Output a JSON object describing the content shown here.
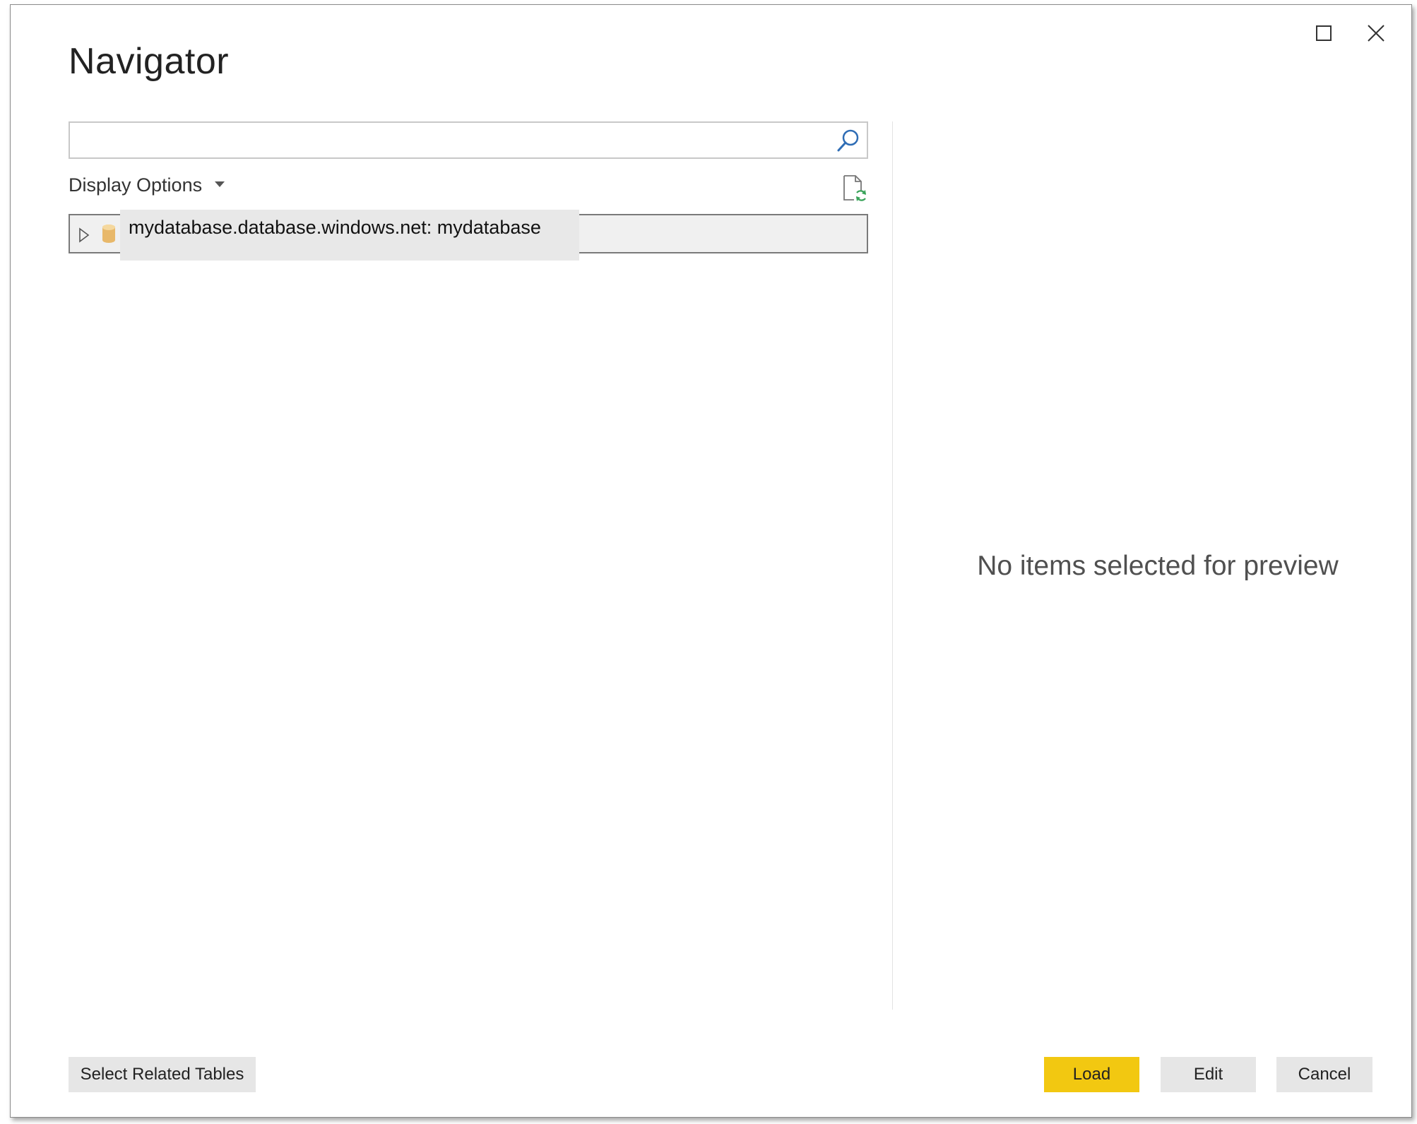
{
  "window": {
    "title": "Navigator",
    "maximize_icon": "maximize-icon",
    "close_icon": "close-icon"
  },
  "search": {
    "value": "",
    "placeholder": "",
    "icon": "search-icon"
  },
  "display_options": {
    "label": "Display Options",
    "icon": "chevron-down-icon"
  },
  "refresh": {
    "icon": "refresh-file-icon"
  },
  "tree": {
    "items": [
      {
        "label": "mydatabase.database.windows.net: mydatabase",
        "icon": "database-icon",
        "expanded": false
      }
    ],
    "tooltip": "mydatabase.database.windows.net: mydatabase"
  },
  "preview": {
    "message": "No items selected for preview"
  },
  "footer": {
    "select_related_label": "Select Related Tables",
    "load_label": "Load",
    "edit_label": "Edit",
    "cancel_label": "Cancel"
  },
  "colors": {
    "load_button": "#f2c811",
    "button_gray": "#e6e6e6",
    "search_icon": "#2f6db5",
    "refresh_accent": "#3aa35a",
    "database_icon": "#e8b86a"
  }
}
